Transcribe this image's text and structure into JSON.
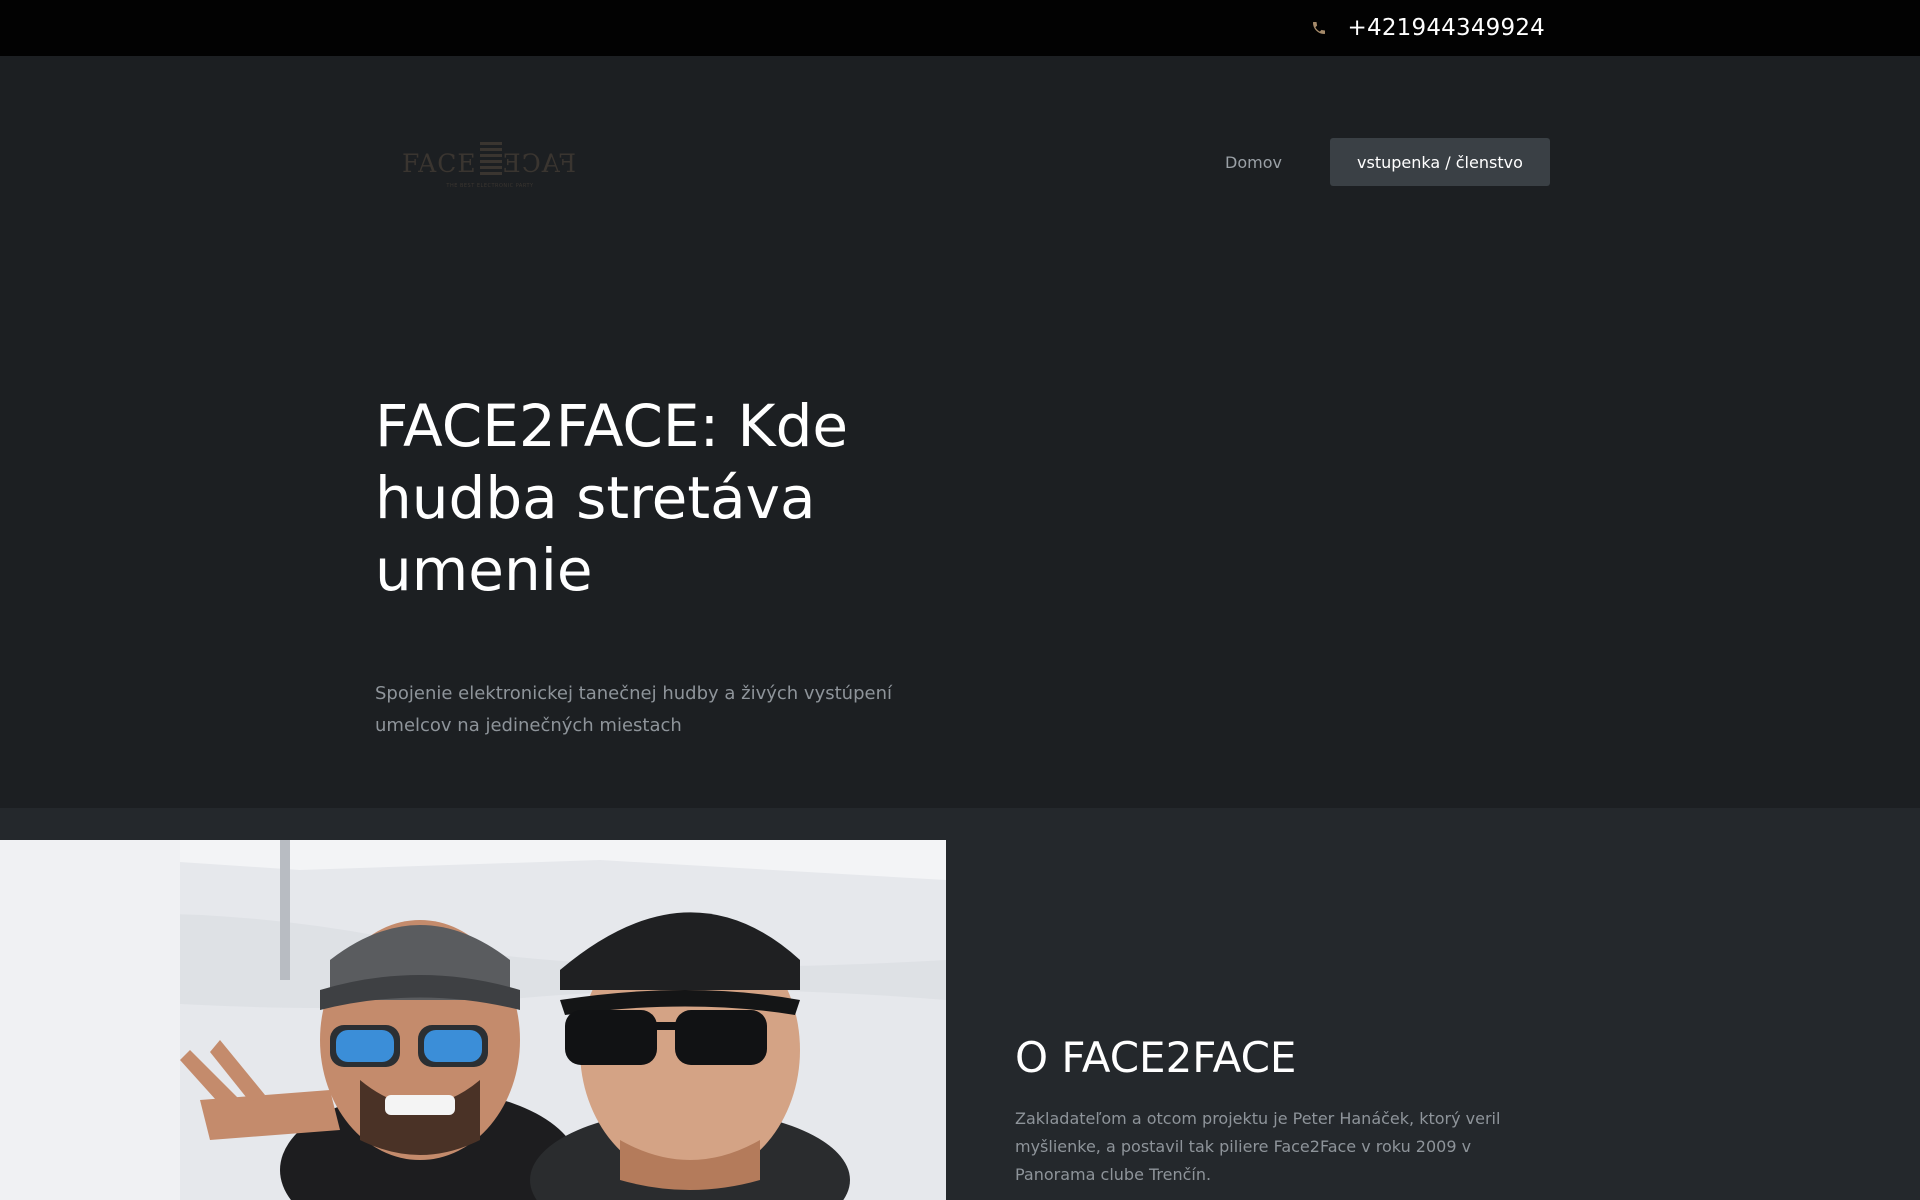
{
  "topbar": {
    "phone_icon": "phone-icon",
    "phone": "+421944349924"
  },
  "header": {
    "logo": {
      "icon": "face2face-logo",
      "text_left": "FACE",
      "text_right": "FACE",
      "tagline": "THE BEST ELECTRONIC PARTY"
    },
    "nav": {
      "home": "Domov",
      "cta": "vstupenka / členstvo"
    }
  },
  "hero": {
    "title": "FACE2FACE: Kde hudba stretáva umenie",
    "subtitle": "Spojenie elektronickej tanečnej hudby a živých vystúpení umelcov na jedinečných miestach"
  },
  "about": {
    "title": "O FACE2FACE",
    "text": "Zakladateľom a otcom projektu je Peter Hanáček, ktorý veril myšlienke, a postavil tak piliere Face2Face v roku 2009 v Panorama clube Trenčín."
  },
  "colors": {
    "topbar_bg": "#020202",
    "header_bg": "#1c1f22",
    "about_bg": "#24282c",
    "button_bg": "#3a4045",
    "accent_icon": "#a58a6a"
  }
}
